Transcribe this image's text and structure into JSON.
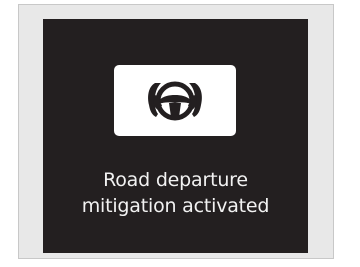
{
  "display": {
    "icon": "road-departure-mitigation-icon",
    "message_line1": "Road departure",
    "message_line2": "mitigation activated"
  },
  "colors": {
    "screen_background": "#231f20",
    "icon_panel": "#ffffff",
    "icon_glyph": "#231f20",
    "text": "#f2f2f2",
    "frame": "#e8e8e8"
  }
}
